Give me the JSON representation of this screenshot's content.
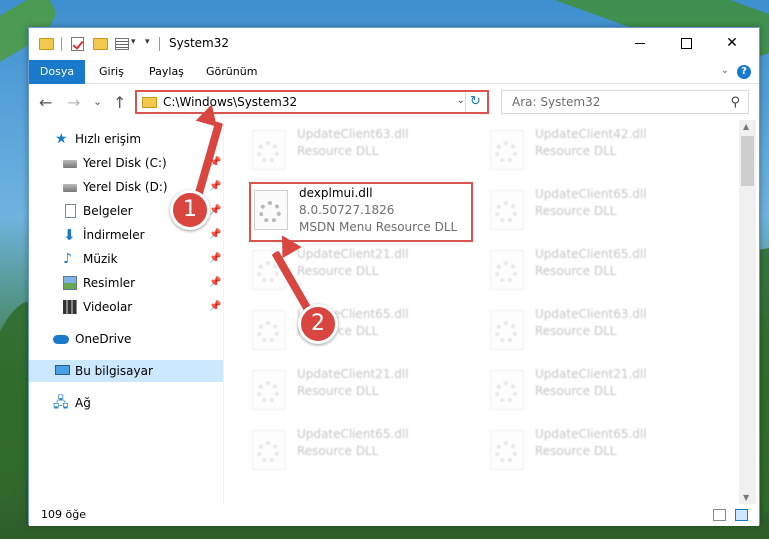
{
  "window": {
    "title": "System32",
    "minimize": "—",
    "maximize": "",
    "close": "✕"
  },
  "ribbon": {
    "tabs": [
      "Dosya",
      "Giriş",
      "Paylaş",
      "Görünüm"
    ],
    "collapse_glyph": "⌄",
    "help_glyph": "?"
  },
  "nav": {
    "back": "←",
    "forward": "→",
    "recent": "⌄",
    "up": "↑"
  },
  "address": {
    "path": "C:\\Windows\\System32",
    "dropdown": "⌄",
    "refresh": "↻"
  },
  "search": {
    "placeholder": "Ara: System32",
    "icon": "⚲"
  },
  "sidebar": {
    "items": [
      {
        "label": "Hızlı erişim",
        "icon": "star-icon"
      },
      {
        "label": "Yerel Disk (C:)",
        "icon": "drive-icon",
        "pinned": true
      },
      {
        "label": "Yerel Disk (D:)",
        "icon": "drive-icon",
        "pinned": true
      },
      {
        "label": "Belgeler",
        "icon": "documents-icon",
        "pinned": true
      },
      {
        "label": "İndirmeler",
        "icon": "downloads-icon",
        "pinned": true
      },
      {
        "label": "Müzik",
        "icon": "music-icon",
        "pinned": true
      },
      {
        "label": "Resimler",
        "icon": "pictures-icon",
        "pinned": true
      },
      {
        "label": "Videolar",
        "icon": "videos-icon",
        "pinned": true
      },
      {
        "label": "OneDrive",
        "icon": "onedrive-icon"
      },
      {
        "label": "Bu bilgisayar",
        "icon": "this-pc-icon",
        "selected": true
      },
      {
        "label": "Ağ",
        "icon": "network-icon"
      }
    ],
    "pin_glyph": "📌"
  },
  "files": [
    {
      "name": "UpdateClient63.dll",
      "sub": "Resource DLL"
    },
    {
      "name": "UpdateClient42.dll",
      "sub": "Resource DLL"
    },
    {
      "name": "dexplmui.dll",
      "version": "8.0.50727.1826",
      "description": "MSDN Menu Resource DLL",
      "highlighted": true
    },
    {
      "name": "UpdateClient65.dll",
      "sub": "Resource DLL"
    },
    {
      "name": "UpdateClient21.dll",
      "sub": "Resource DLL"
    },
    {
      "name": "UpdateClient65.dll",
      "sub": "Resource DLL"
    },
    {
      "name": "UpdateClient65.dll",
      "sub": "Resource DLL"
    },
    {
      "name": "UpdateClient63.dll",
      "sub": "Resource DLL"
    },
    {
      "name": "UpdateClient21.dll",
      "sub": "Resource DLL"
    },
    {
      "name": "UpdateClient21.dll",
      "sub": "Resource DLL"
    },
    {
      "name": "UpdateClient65.dll",
      "sub": "Resource DLL"
    },
    {
      "name": "UpdateClient65.dll",
      "sub": "Resource DLL"
    }
  ],
  "status": {
    "item_count": "109 öğe"
  },
  "markers": [
    "1",
    "2"
  ],
  "colors": {
    "accent": "#1979ca",
    "highlight_border": "#d9534f",
    "marker": "#d9453f",
    "selected_bg": "#cce8ff"
  }
}
